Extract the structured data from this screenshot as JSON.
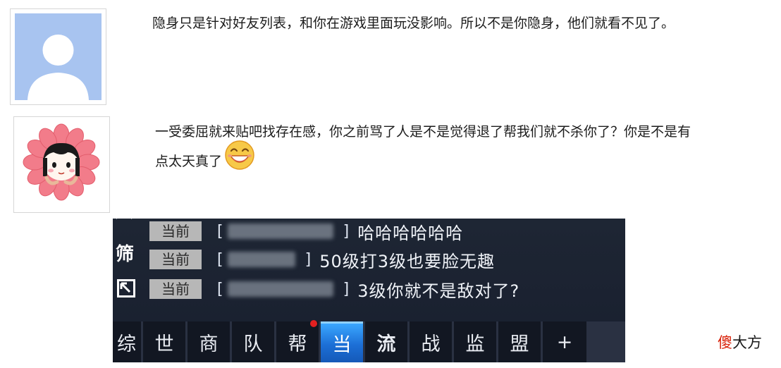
{
  "posts": [
    {
      "text": "隐身只是针对好友列表，和你在游戏里面玩没影响。所以不是你隐身，他们就看不见了。"
    },
    {
      "line1": "一受委屈就来贴吧找存在感，你之前骂了人是不是觉得退了帮我们就不杀你了？你是不是有",
      "line2": "点太天真了",
      "emoji": "laughing-emoji-icon"
    }
  ],
  "game_chat": {
    "side_glyphs": [
      "筛"
    ],
    "rows": [
      {
        "channel": "当前",
        "message": "哈哈哈哈哈哈"
      },
      {
        "channel": "当前",
        "message": "50级打3级也要脸无趣"
      },
      {
        "channel": "当前",
        "message": "3级你就不是敌对了?"
      }
    ],
    "tabs": [
      "综",
      "世",
      "商",
      "队",
      "帮",
      "当",
      "流",
      "战",
      "监",
      "盟",
      "+"
    ],
    "active_tab": "当"
  },
  "watermark": {
    "red": "傻",
    "rest": "大方"
  },
  "colors": {
    "active_tab": "#1c6fd6",
    "notify_dot": "#e32020",
    "watermark_red": "#d81e06"
  }
}
